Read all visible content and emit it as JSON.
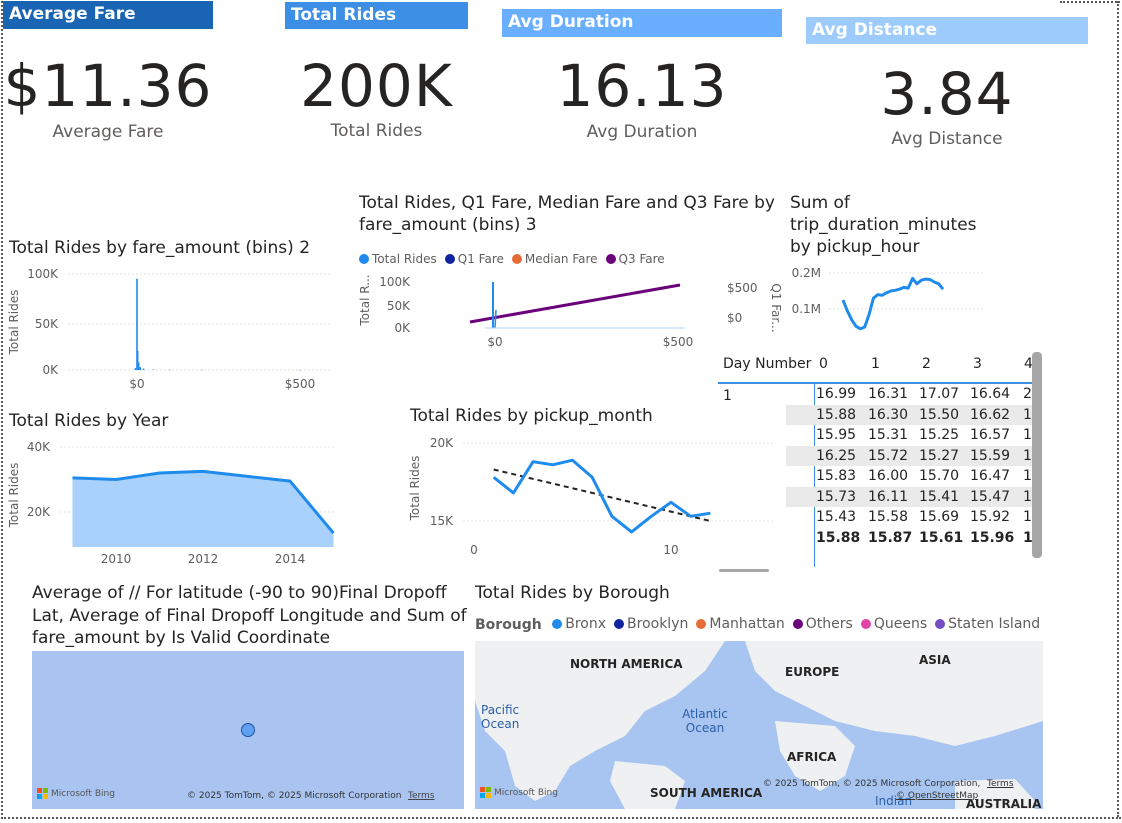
{
  "kpis": [
    {
      "header": "Average Fare",
      "value": "$11.36",
      "label": "Average Fare",
      "color": "#1a64b4"
    },
    {
      "header": "Total Rides",
      "value": "200K",
      "label": "Total Rides",
      "color": "#3d8fe6"
    },
    {
      "header": "Avg Duration",
      "value": "16.13",
      "label": "Avg Duration",
      "color": "#6aafff"
    },
    {
      "header": "Avg Distance",
      "value": "3.84",
      "label": "Avg Distance",
      "color": "#9dcbfb"
    }
  ],
  "charts": {
    "fare_bins": {
      "title": "Total Rides by fare_amount (bins) 2",
      "ylabel": "Total Rides",
      "yticks": [
        "100K",
        "50K",
        "0K"
      ],
      "xticks": [
        "$0",
        "$500"
      ]
    },
    "fare_combo": {
      "title": "Total Rides, Q1 Fare, Median Fare and Q3 Fare by fare_amount (bins) 3",
      "ylabel": "Total R...",
      "y2label": "Q1 Far...",
      "yticks": [
        "100K",
        "50K",
        "0K"
      ],
      "y2ticks": [
        "$500",
        "$0"
      ],
      "xticks": [
        "$0",
        "$500"
      ],
      "legend": [
        {
          "name": "Total Rides",
          "color": "#1f8bec"
        },
        {
          "name": "Q1 Fare",
          "color": "#12239e"
        },
        {
          "name": "Median Fare",
          "color": "#e66c37"
        },
        {
          "name": "Q3 Fare",
          "color": "#6b007b"
        }
      ]
    },
    "duration_hour": {
      "title": "Sum of trip_duration_minutes by pickup_hour",
      "yticks": [
        "0.2M",
        "0.1M"
      ]
    },
    "rides_year": {
      "title": "Total Rides by Year",
      "ylabel": "Total Rides",
      "yticks": [
        "40K",
        "20K"
      ],
      "xticks": [
        "2010",
        "2012",
        "2014"
      ]
    },
    "rides_month": {
      "title": "Total Rides by pickup_month",
      "ylabel": "Total Rides",
      "yticks": [
        "20K",
        "15K"
      ],
      "xticks": [
        "0",
        "10"
      ]
    },
    "dropoff": {
      "title": "Average of // For latitude (-90 to 90)Final Dropoff Lat, Average of Final Dropoff Longitude and Sum of fare_amount by Is Valid Coordinate",
      "attribution": "© 2025 TomTom, © 2025 Microsoft Corporation",
      "terms": "Terms",
      "bing": "Microsoft Bing"
    },
    "borough": {
      "title": "Total Rides by Borough",
      "legend_title": "Borough",
      "legend": [
        {
          "name": "Bronx",
          "color": "#1f8bec"
        },
        {
          "name": "Brooklyn",
          "color": "#12239e"
        },
        {
          "name": "Manhattan",
          "color": "#e66c37"
        },
        {
          "name": "Others",
          "color": "#6b007b"
        },
        {
          "name": "Queens",
          "color": "#e044a7"
        },
        {
          "name": "Staten Island",
          "color": "#744ec2"
        }
      ],
      "labels": {
        "na": "NORTH AMERICA",
        "europe": "EUROPE",
        "asia": "ASIA",
        "africa": "AFRICA",
        "sa": "SOUTH AMERICA",
        "aus": "AUSTRALIA",
        "pacific": "Pacific Ocean",
        "atlantic": "Atlantic Ocean",
        "indian": "Indian"
      },
      "attribution": "© 2025 TomTom, © 2025 Microsoft Corporation,",
      "terms": "Terms",
      "osm": "© OpenStreetMap",
      "bing": "Microsoft Bing"
    }
  },
  "matrix": {
    "corner": "Day Number",
    "cols": [
      "0",
      "1",
      "2",
      "3",
      "4"
    ],
    "group": "1",
    "rows": [
      [
        "16.99",
        "16.31",
        "17.07",
        "16.64",
        "2"
      ],
      [
        "15.88",
        "16.30",
        "15.50",
        "16.62",
        "1"
      ],
      [
        "15.95",
        "15.31",
        "15.25",
        "16.57",
        "1"
      ],
      [
        "16.25",
        "15.72",
        "15.27",
        "15.59",
        "1"
      ],
      [
        "15.83",
        "16.00",
        "15.70",
        "16.47",
        "1"
      ],
      [
        "15.73",
        "16.11",
        "15.41",
        "15.47",
        "1"
      ],
      [
        "15.43",
        "15.58",
        "15.69",
        "15.92",
        "1"
      ]
    ],
    "total": [
      "15.88",
      "15.87",
      "15.61",
      "15.96",
      "1"
    ]
  },
  "chart_data": [
    {
      "type": "bar",
      "title": "Total Rides by fare_amount (bins) 2",
      "xlabel": "",
      "ylabel": "Total Rides",
      "ylim": [
        0,
        100000
      ],
      "x": [
        -5,
        0,
        2,
        5,
        10,
        20,
        50,
        100,
        200,
        500
      ],
      "values": [
        2000,
        95000,
        20000,
        8000,
        3000,
        1500,
        500,
        300,
        200,
        100
      ]
    },
    {
      "type": "line",
      "title": "Sum of trip_duration_minutes by pickup_hour",
      "ylim": [
        0,
        200000
      ],
      "x": [
        0,
        1,
        2,
        3,
        4,
        5,
        6,
        7,
        8,
        9,
        10,
        11,
        12,
        13,
        14,
        15,
        16,
        17,
        18,
        19,
        20,
        21,
        22,
        23
      ],
      "values": [
        125000,
        95000,
        70000,
        52000,
        45000,
        50000,
        85000,
        130000,
        140000,
        138000,
        145000,
        150000,
        152000,
        155000,
        160000,
        158000,
        185000,
        170000,
        180000,
        183000,
        182000,
        175000,
        170000,
        155000
      ]
    },
    {
      "type": "area",
      "title": "Total Rides by Year",
      "ylabel": "Total Rides",
      "ylim": [
        0,
        40000
      ],
      "x": [
        2009,
        2010,
        2011,
        2012,
        2013,
        2014,
        2015
      ],
      "values": [
        30500,
        30000,
        32000,
        32500,
        31000,
        29500,
        13500
      ]
    },
    {
      "type": "line",
      "title": "Total Rides by pickup_month",
      "ylabel": "Total Rides",
      "ylim": [
        14000,
        20000
      ],
      "x": [
        1,
        2,
        3,
        4,
        5,
        6,
        7,
        8,
        9,
        10,
        11,
        12
      ],
      "values": [
        17800,
        16800,
        18800,
        18600,
        18900,
        17800,
        15300,
        14300,
        15300,
        16200,
        15300,
        15500
      ],
      "trend": [
        18300,
        15000
      ]
    }
  ]
}
